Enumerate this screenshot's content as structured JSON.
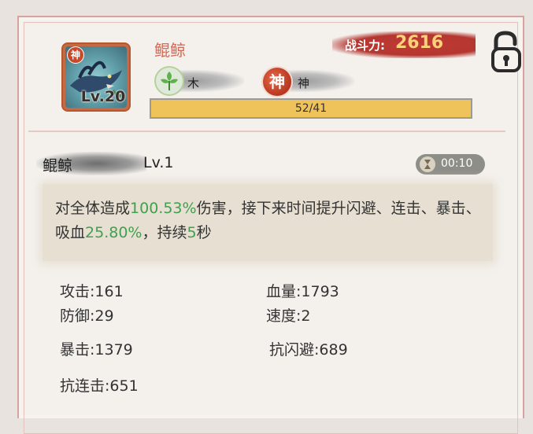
{
  "pet": {
    "name": "鲲鲸",
    "level": "Lv.20",
    "avatar_mark": "神",
    "element_label": "木",
    "type_icon": "神",
    "type_label": "神",
    "exp_text": "52/41",
    "exp_fill_fraction": 1.0
  },
  "combat_power": {
    "label": "战斗力:",
    "value": "2616"
  },
  "skill": {
    "name": "鲲鲸",
    "level": "Lv.1",
    "cooldown": "00:10",
    "description": [
      {
        "text": "对全体造成",
        "hl": false
      },
      {
        "text": "100.53%",
        "hl": true
      },
      {
        "text": "伤害，接下来时间提升闪避、连击、暴击、吸血",
        "hl": false
      },
      {
        "text": "25.80%",
        "hl": true
      },
      {
        "text": "，持续",
        "hl": false
      },
      {
        "text": "5",
        "hl": true
      },
      {
        "text": "秒",
        "hl": false
      }
    ]
  },
  "stats": {
    "attack": "攻击:161",
    "hp": "血量:1793",
    "defense": "防御:29",
    "speed": "速度:2",
    "crit": "暴击:1379",
    "anti_dodge": "抗闪避:689",
    "anti_combo": "抗连击:651"
  },
  "colors": {
    "name": "#d06c58",
    "highlight": "#3fa14d",
    "exp_fill": "#efc25a",
    "power_bg": "#b43630"
  },
  "icons": {
    "lock": "unlocked-padlock-icon",
    "element": "wood-leaf-icon",
    "cooldown": "hourglass-icon"
  }
}
